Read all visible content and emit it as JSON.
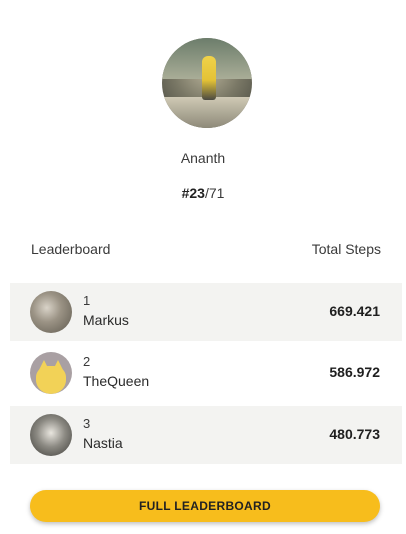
{
  "profile": {
    "name": "Ananth",
    "rank_position": "#23",
    "rank_total": "/71"
  },
  "leaderboard": {
    "title": "Leaderboard",
    "column_label": "Total Steps",
    "rows": [
      {
        "rank": "1",
        "name": "Markus",
        "steps": "669.421"
      },
      {
        "rank": "2",
        "name": "TheQueen",
        "steps": "586.972"
      },
      {
        "rank": "3",
        "name": "Nastia",
        "steps": "480.773"
      }
    ]
  },
  "button": {
    "label": "FULL LEADERBOARD"
  },
  "colors": {
    "accent": "#f7bd1c",
    "row_shade": "#f3f3f1"
  }
}
